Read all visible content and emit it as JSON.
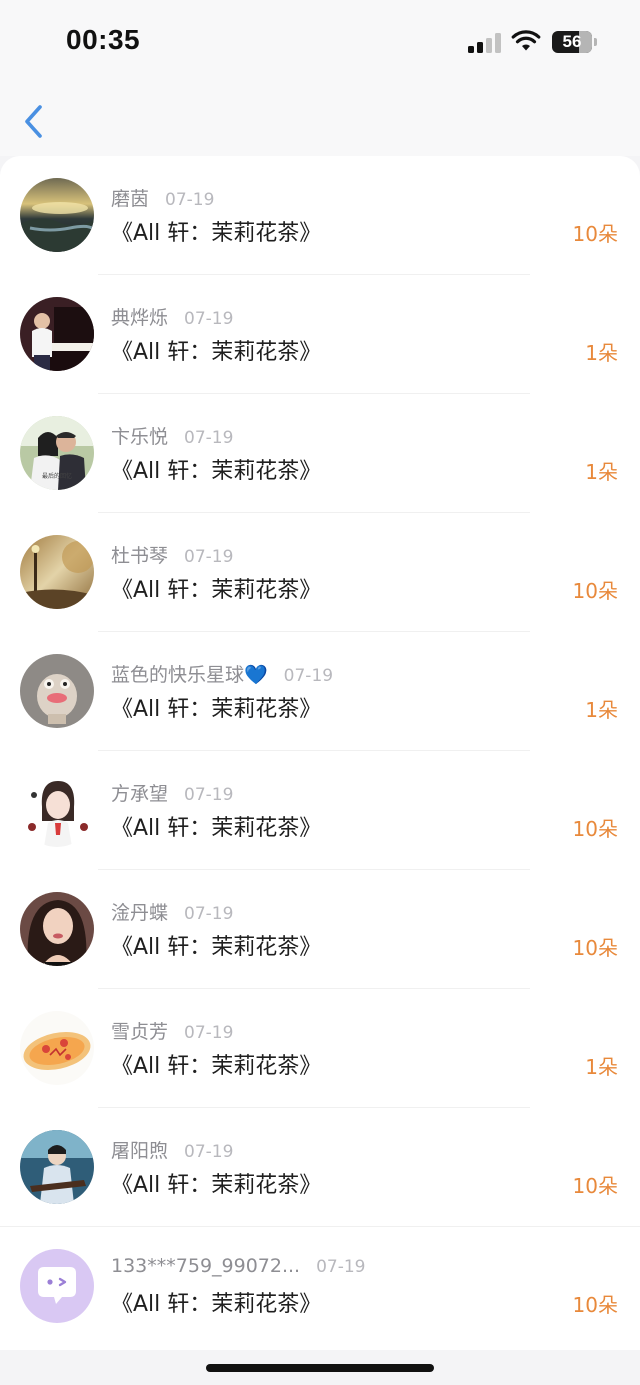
{
  "status": {
    "time": "00:35",
    "battery": "56"
  },
  "rows": [
    {
      "name": "磨茵",
      "date": "07-19",
      "title": "《All 轩：茉莉花茶》",
      "amount": "10朵",
      "avatar": "landscape-lake"
    },
    {
      "name": "典烨烁",
      "date": "07-19",
      "title": "《All 轩：茉莉花茶》",
      "amount": "1朵",
      "avatar": "piano-player"
    },
    {
      "name": "卞乐悦",
      "date": "07-19",
      "title": "《All 轩：茉莉花茶》",
      "amount": "1朵",
      "avatar": "couple-photo",
      "avatar_caption": "最后的回忆"
    },
    {
      "name": "杜书琴",
      "date": "07-19",
      "title": "《All 轩：茉莉花茶》",
      "amount": "10朵",
      "avatar": "autumn-park"
    },
    {
      "name": "蓝色的快乐星球💙",
      "date": "07-19",
      "title": "《All 轩：茉莉花茶》",
      "amount": "1朵",
      "avatar": "frog-plush"
    },
    {
      "name": "方承望",
      "date": "07-19",
      "title": "《All 轩：茉莉花茶》",
      "amount": "10朵",
      "avatar": "girl-illustration"
    },
    {
      "name": "淦丹蝶",
      "date": "07-19",
      "title": "《All 轩：茉莉花茶》",
      "amount": "10朵",
      "avatar": "woman-portrait"
    },
    {
      "name": "雪贞芳",
      "date": "07-19",
      "title": "《All 轩：茉莉花茶》",
      "amount": "1朵",
      "avatar": "pizza-drawing"
    },
    {
      "name": "屠阳煦",
      "date": "07-19",
      "title": "《All 轩：茉莉花茶》",
      "amount": "10朵",
      "avatar": "guqin-player"
    },
    {
      "name": "133***759_99072...",
      "date": "07-19",
      "title": "《All 轩：茉莉花茶》",
      "amount": "10朵",
      "avatar": "default-chat-avatar"
    }
  ],
  "colors": {
    "amount": "#e8893b",
    "back_arrow": "#4a90e2",
    "default_avatar": "#d9c8f3"
  }
}
